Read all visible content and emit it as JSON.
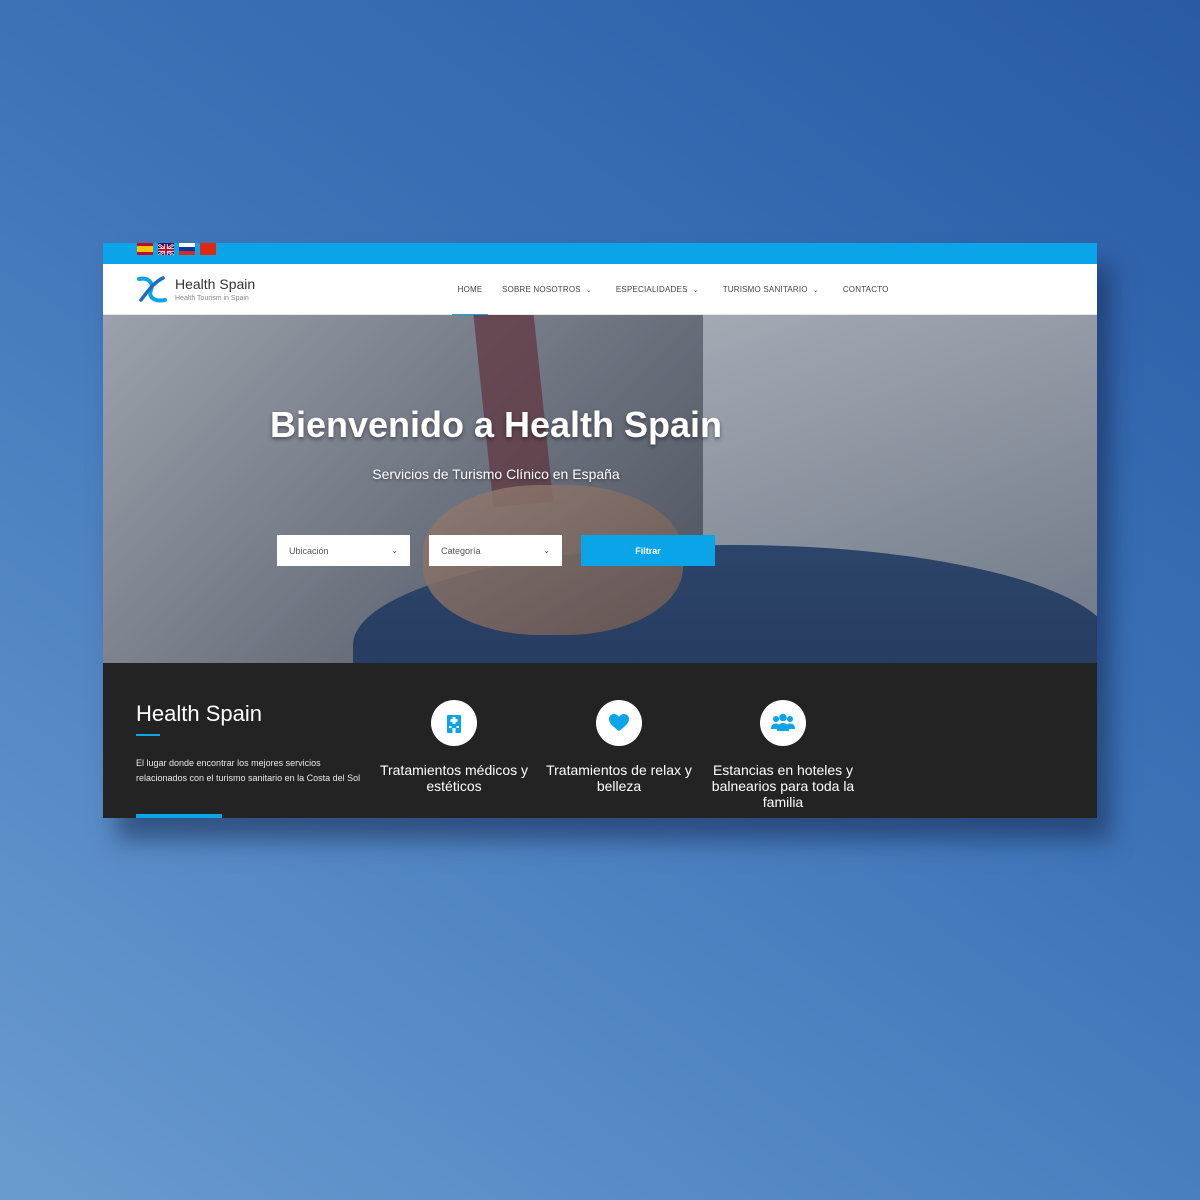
{
  "colors": {
    "accent": "#0aa4e8",
    "dark_section": "#232323",
    "white": "#ffffff"
  },
  "languages": [
    {
      "name": "Español",
      "icon": "spain-flag-icon"
    },
    {
      "name": "English",
      "icon": "uk-flag-icon"
    },
    {
      "name": "Русский",
      "icon": "russia-flag-icon"
    },
    {
      "name": "中文",
      "icon": "china-flag-icon"
    }
  ],
  "header": {
    "brand_title": "Health Spain",
    "brand_subtitle": "Health Tourism in Spain",
    "logo_icon": "health-spain-logo-icon"
  },
  "nav": {
    "home": "HOME",
    "sobre_nosotros": "SOBRE NOSOTROS",
    "especialidades": "ESPECIALIDADES",
    "turismo_sanitario": "TURISMO SANITARIO",
    "contacto": "CONTACTO",
    "active": "HOME"
  },
  "hero": {
    "title": "Bienvenido a Health Spain",
    "subtitle": "Servicios de Turismo Clínico en España",
    "location_select": "Ubicación",
    "category_select": "Categoría",
    "filter_button": "Filtrar"
  },
  "about": {
    "title": "Health Spain",
    "text": "El lugar donde encontrar los mejores servicios relacionados con el turismo sanitario en la Costa del Sol"
  },
  "features": [
    {
      "icon": "hospital-icon",
      "label": "Tratamientos médicos y estéticos"
    },
    {
      "icon": "heart-icon",
      "label": "Tratamientos de relax y belleza"
    },
    {
      "icon": "family-group-icon",
      "label": "Estancias en hoteles y balnearios para toda la familia"
    }
  ]
}
